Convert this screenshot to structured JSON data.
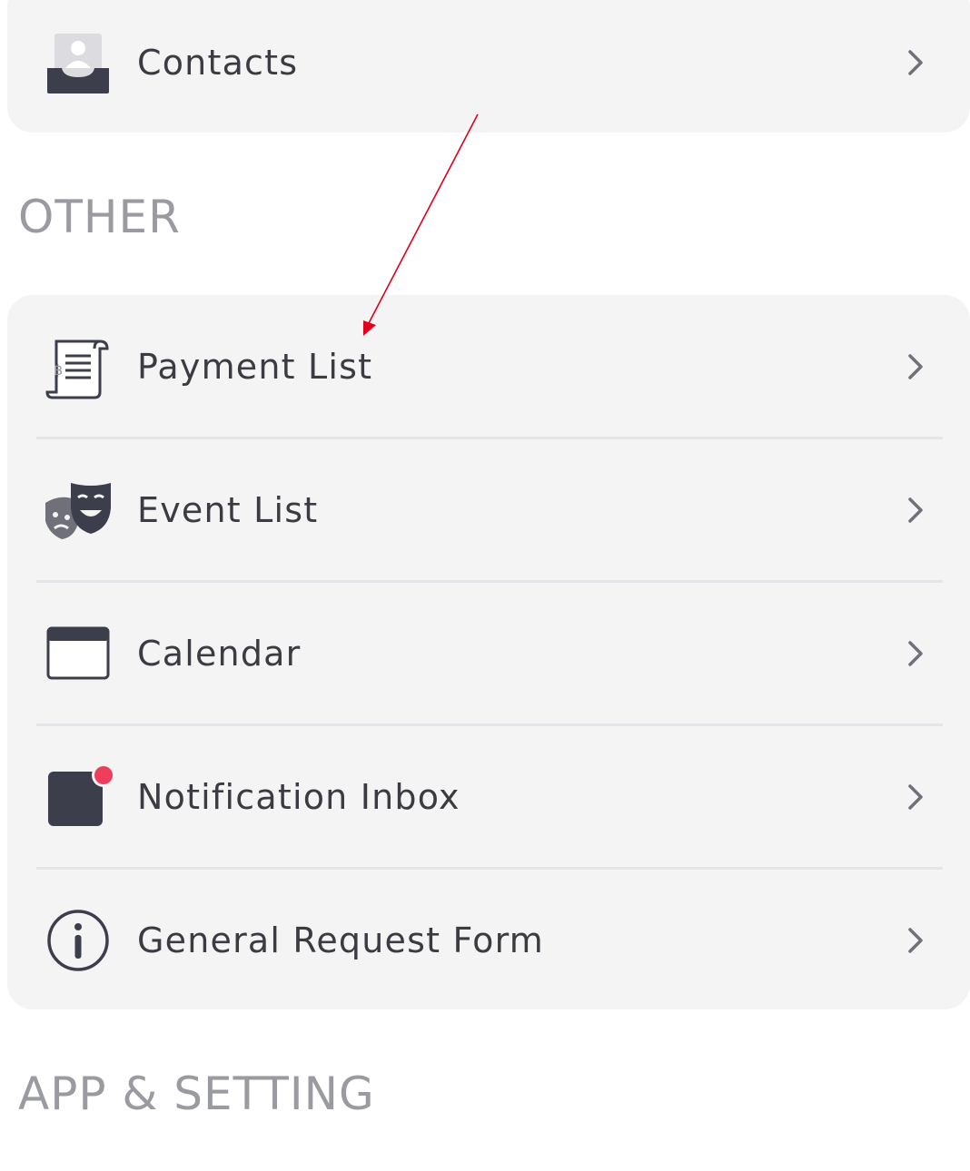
{
  "contacts": {
    "label": "Contacts",
    "icon": "contacts-inbox-icon"
  },
  "sections": {
    "other_title": "OTHER",
    "app_setting_title": "APP & SETTING"
  },
  "other_items": [
    {
      "label": "Payment List",
      "icon": "payment-receipt-icon"
    },
    {
      "label": "Event List",
      "icon": "theater-masks-icon"
    },
    {
      "label": "Calendar",
      "icon": "calendar-icon"
    },
    {
      "label": "Notification Inbox",
      "icon": "notification-inbox-icon"
    },
    {
      "label": "General Request Form",
      "icon": "info-icon"
    }
  ],
  "colors": {
    "card_background": "#f4f4f5",
    "text": "#3b3c42",
    "section_title": "#9a9ba1",
    "notification_dot": "#ef3e5c",
    "annotation_arrow": "#e0001b"
  }
}
